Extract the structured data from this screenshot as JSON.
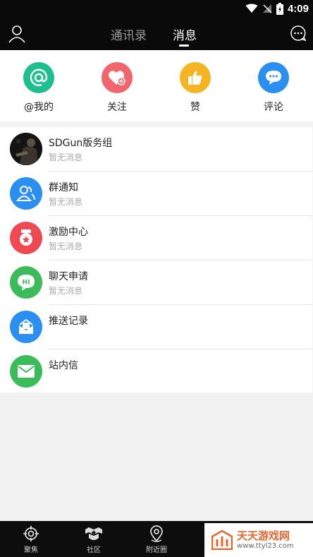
{
  "status": {
    "time": "4:09"
  },
  "header": {
    "tabs": [
      {
        "label": "通讯录",
        "active": false
      },
      {
        "label": "消息",
        "active": true
      }
    ]
  },
  "quick_actions": [
    {
      "label": "@我的",
      "icon": "at-icon",
      "color": "#1dbf8f"
    },
    {
      "label": "关注",
      "icon": "heart-plus-icon",
      "color": "#f0666c"
    },
    {
      "label": "赞",
      "icon": "thumbs-up-icon",
      "color": "#f5b522"
    },
    {
      "label": "评论",
      "icon": "comment-icon",
      "color": "#2a8ff0"
    }
  ],
  "messages": [
    {
      "title": "SDGun版务组",
      "subtitle": "暂无消息",
      "icon": "group-photo-avatar"
    },
    {
      "title": "群通知",
      "subtitle": "暂无消息",
      "icon": "group-users-icon",
      "color": "#2a8ff0"
    },
    {
      "title": "激励中心",
      "subtitle": "暂无消息",
      "icon": "medal-icon",
      "color": "#ef4a52"
    },
    {
      "title": "聊天申请",
      "subtitle": "暂无消息",
      "icon": "hi-bubble-icon",
      "color": "#3cbb5b"
    },
    {
      "title": "推送记录",
      "subtitle": "",
      "icon": "inbox-icon",
      "color": "#2a8ff0"
    },
    {
      "title": "站内信",
      "subtitle": "",
      "icon": "mail-icon",
      "color": "#3cbb5b"
    }
  ],
  "bottom_nav": [
    {
      "label": "聚焦",
      "icon": "target-icon"
    },
    {
      "label": "社区",
      "icon": "badge-icon"
    },
    {
      "label": "附近圈",
      "icon": "location-icon"
    }
  ],
  "watermark": {
    "title": "天天游戏网",
    "url": "www.ttyl23.com"
  }
}
